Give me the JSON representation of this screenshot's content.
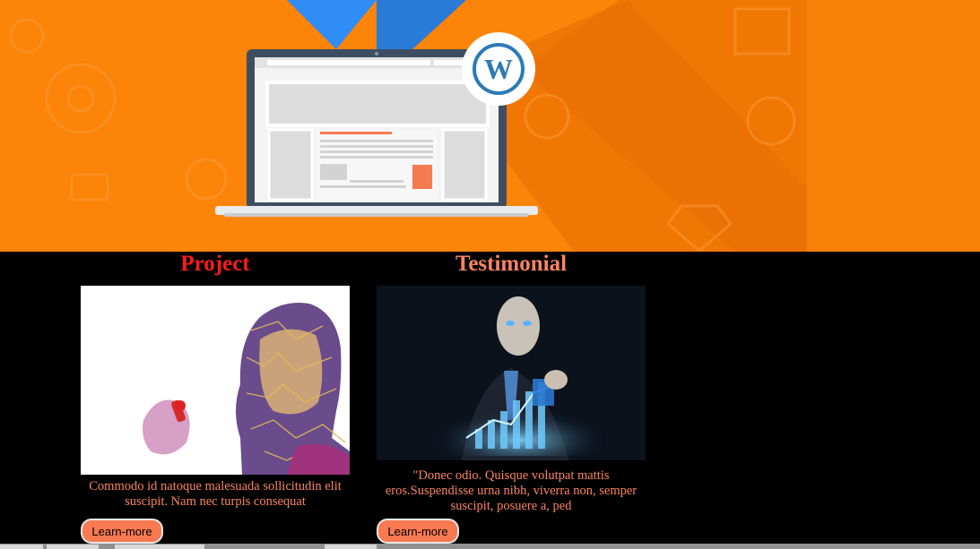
{
  "hero": {
    "brand_icon": "wordpress-logo-icon",
    "illustration": "laptop-website-icon",
    "colors": {
      "background": "#f98008",
      "accent": "#fa6e45",
      "blue": "#2a8bf2"
    }
  },
  "cards": [
    {
      "title": "Project",
      "image_icon": "robot-woman-circuit-image",
      "text": "Commodo id natoque malesuada sollicitudin elit suscipit. Nam nec turpis consequat",
      "button_label": "Learn-more"
    },
    {
      "title": "Testimonial",
      "image_icon": "android-businessman-chart-image",
      "text": "\"Donec odio. Quisque volutpat mattis eros.Suspendisse urna nibh, viverra non, semper suscipit, posuere a, ped",
      "button_label": "Learn-more"
    }
  ],
  "colors": {
    "title_project": "#ff1a1a",
    "title_testimonial": "#fa8461",
    "text": "#fa8461",
    "button": "#f97950"
  }
}
